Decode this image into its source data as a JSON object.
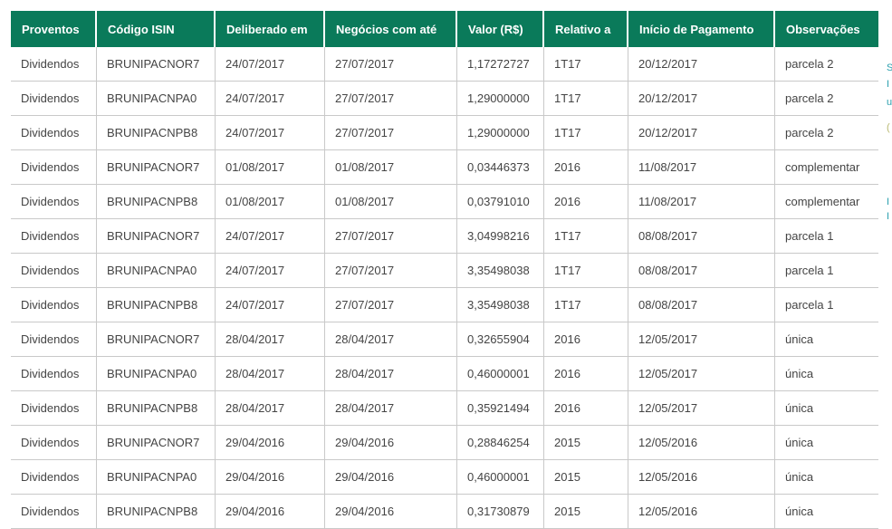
{
  "table": {
    "headers": [
      "Proventos",
      "Código ISIN",
      "Deliberado em",
      "Negócios com até",
      "Valor (R$)",
      "Relativo a",
      "Início de Pagamento",
      "Observações"
    ],
    "rows": [
      [
        "Dividendos",
        "BRUNIPACNOR7",
        "24/07/2017",
        "27/07/2017",
        "1,17272727",
        "1T17",
        "20/12/2017",
        "parcela 2"
      ],
      [
        "Dividendos",
        "BRUNIPACNPA0",
        "24/07/2017",
        "27/07/2017",
        "1,29000000",
        "1T17",
        "20/12/2017",
        "parcela 2"
      ],
      [
        "Dividendos",
        "BRUNIPACNPB8",
        "24/07/2017",
        "27/07/2017",
        "1,29000000",
        "1T17",
        "20/12/2017",
        "parcela 2"
      ],
      [
        "Dividendos",
        "BRUNIPACNOR7",
        "01/08/2017",
        "01/08/2017",
        "0,03446373",
        "2016",
        "11/08/2017",
        "complementar"
      ],
      [
        "Dividendos",
        "BRUNIPACNPB8",
        "01/08/2017",
        "01/08/2017",
        "0,03791010",
        "2016",
        "11/08/2017",
        "complementar"
      ],
      [
        "Dividendos",
        "BRUNIPACNOR7",
        "24/07/2017",
        "27/07/2017",
        "3,04998216",
        "1T17",
        "08/08/2017",
        "parcela 1"
      ],
      [
        "Dividendos",
        "BRUNIPACNPA0",
        "24/07/2017",
        "27/07/2017",
        "3,35498038",
        "1T17",
        "08/08/2017",
        "parcela 1"
      ],
      [
        "Dividendos",
        "BRUNIPACNPB8",
        "24/07/2017",
        "27/07/2017",
        "3,35498038",
        "1T17",
        "08/08/2017",
        "parcela 1"
      ],
      [
        "Dividendos",
        "BRUNIPACNOR7",
        "28/04/2017",
        "28/04/2017",
        "0,32655904",
        "2016",
        "12/05/2017",
        "única"
      ],
      [
        "Dividendos",
        "BRUNIPACNPA0",
        "28/04/2017",
        "28/04/2017",
        "0,46000001",
        "2016",
        "12/05/2017",
        "única"
      ],
      [
        "Dividendos",
        "BRUNIPACNPB8",
        "28/04/2017",
        "28/04/2017",
        "0,35921494",
        "2016",
        "12/05/2017",
        "única"
      ],
      [
        "Dividendos",
        "BRUNIPACNOR7",
        "29/04/2016",
        "29/04/2016",
        "0,28846254",
        "2015",
        "12/05/2016",
        "única"
      ],
      [
        "Dividendos",
        "BRUNIPACNPA0",
        "29/04/2016",
        "29/04/2016",
        "0,46000001",
        "2015",
        "12/05/2016",
        "única"
      ],
      [
        "Dividendos",
        "BRUNIPACNPB8",
        "29/04/2016",
        "29/04/2016",
        "0,31730879",
        "2015",
        "12/05/2016",
        "única"
      ]
    ]
  },
  "colors": {
    "header_bg": "#0a7a5a",
    "header_text": "#ffffff",
    "cell_text": "#444444",
    "grid_line": "#c9c9c9",
    "edge_teal": "#2a9fae",
    "edge_olive": "#b8b870"
  }
}
